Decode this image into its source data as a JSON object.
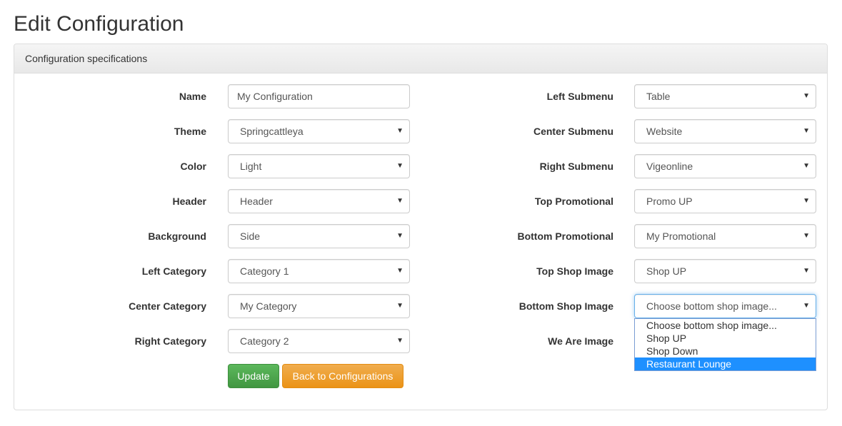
{
  "page_title": "Edit Configuration",
  "panel_heading": "Configuration specifications",
  "left_fields": [
    {
      "label": "Name",
      "value": "My Configuration",
      "kind": "input"
    },
    {
      "label": "Theme",
      "value": "Springcattleya",
      "kind": "select"
    },
    {
      "label": "Color",
      "value": "Light",
      "kind": "select"
    },
    {
      "label": "Header",
      "value": "Header",
      "kind": "select"
    },
    {
      "label": "Background",
      "value": "Side",
      "kind": "select"
    },
    {
      "label": "Left Category",
      "value": "Category 1",
      "kind": "select"
    },
    {
      "label": "Center Category",
      "value": "My Category",
      "kind": "select"
    },
    {
      "label": "Right Category",
      "value": "Category 2",
      "kind": "select"
    }
  ],
  "right_fields": [
    {
      "label": "Left Submenu",
      "value": "Table",
      "kind": "select"
    },
    {
      "label": "Center Submenu",
      "value": "Website",
      "kind": "select"
    },
    {
      "label": "Right Submenu",
      "value": "Vigeonline",
      "kind": "select"
    },
    {
      "label": "Top Promotional",
      "value": "Promo UP",
      "kind": "select"
    },
    {
      "label": "Bottom Promotional",
      "value": "My Promotional",
      "kind": "select"
    },
    {
      "label": "Top Shop Image",
      "value": "Shop UP",
      "kind": "select"
    },
    {
      "label": "Bottom Shop Image",
      "value": "Choose bottom shop image...",
      "kind": "select"
    },
    {
      "label": "We Are Image",
      "value": "",
      "kind": "hidden"
    }
  ],
  "dropdown": {
    "options": [
      "Choose bottom shop image...",
      "Shop UP",
      "Shop Down",
      "Restaurant Lounge"
    ],
    "highlighted": "Restaurant Lounge"
  },
  "buttons": {
    "update": "Update",
    "back": "Back to Configurations"
  },
  "caret_glyph": "▼",
  "colors": {
    "update_green": "#5cb85c",
    "back_orange": "#f0ad4e",
    "highlight_blue": "#1e90ff",
    "focus_blue": "#66afe9"
  }
}
